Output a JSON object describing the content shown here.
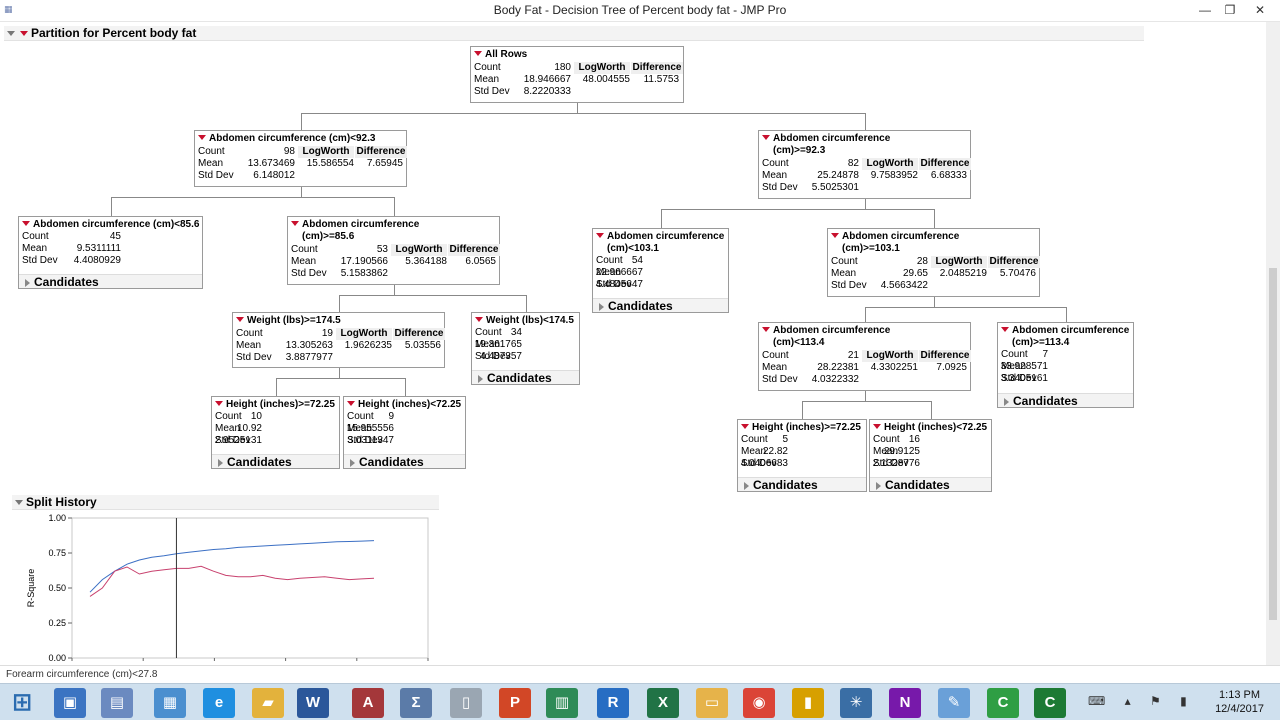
{
  "window": {
    "title": "Body Fat - Decision Tree of Percent body fat - JMP Pro",
    "minimize": "—",
    "maximize": "❐",
    "close": "✕"
  },
  "partition": {
    "header": "Partition for Percent body fat",
    "labels": {
      "count": "Count",
      "mean": "Mean",
      "std": "Std Dev",
      "logworth": "LogWorth",
      "difference": "Difference",
      "candidates": "Candidates"
    }
  },
  "nodes": [
    {
      "id": "root",
      "title": "All Rows",
      "title2": "",
      "count": "180",
      "mean": "18.946667",
      "std": "8.2220333",
      "logworth": "48.004555",
      "difference": "11.5753",
      "candidates": false
    },
    {
      "id": "n1",
      "title": "Abdomen circumference (cm)<92.3",
      "title2": "",
      "count": "98",
      "mean": "13.673469",
      "std": "6.148012",
      "logworth": "15.586554",
      "difference": "7.65945",
      "candidates": false
    },
    {
      "id": "n2",
      "title": "Abdomen circumference",
      "title2": "(cm)>=92.3",
      "count": "82",
      "mean": "25.24878",
      "std": "5.5025301",
      "logworth": "9.7583952",
      "difference": "6.68333",
      "candidates": false
    },
    {
      "id": "n3",
      "title": "Abdomen circumference (cm)<85.6",
      "title2": "",
      "count": "45",
      "mean": "9.5311111",
      "std": "4.4080929",
      "logworth": "",
      "difference": "",
      "candidates": true
    },
    {
      "id": "n4",
      "title": "Abdomen circumference",
      "title2": "(cm)>=85.6",
      "count": "53",
      "mean": "17.190566",
      "std": "5.1583862",
      "logworth": "5.364188",
      "difference": "6.0565",
      "candidates": false
    },
    {
      "id": "n5",
      "title": "Abdomen circumference",
      "title2": "(cm)<103.1",
      "count": "54",
      "mean": "22.966667",
      "std": "4.4845647",
      "logworth": "",
      "difference": "",
      "candidates": true
    },
    {
      "id": "n6",
      "title": "Abdomen circumference",
      "title2": "(cm)>=103.1",
      "count": "28",
      "mean": "29.65",
      "std": "4.5663422",
      "logworth": "2.0485219",
      "difference": "5.70476",
      "candidates": false
    },
    {
      "id": "n7",
      "title": "Weight (lbs)>=174.5",
      "title2": "",
      "count": "19",
      "mean": "13.305263",
      "std": "3.8877977",
      "logworth": "1.9626235",
      "difference": "5.03556",
      "candidates": false
    },
    {
      "id": "n8",
      "title": "Weight (lbs)<174.5",
      "title2": "",
      "count": "34",
      "mean": "19.361765",
      "std": "4.487357",
      "logworth": "",
      "difference": "",
      "candidates": true
    },
    {
      "id": "n9",
      "title": "Abdomen circumference",
      "title2": "(cm)<113.4",
      "count": "21",
      "mean": "28.22381",
      "std": "4.0322332",
      "logworth": "4.3302251",
      "difference": "7.0925",
      "candidates": false
    },
    {
      "id": "n10",
      "title": "Abdomen circumference",
      "title2": "(cm)>=113.4",
      "count": "7",
      "mean": "33.928571",
      "std": "3.3405161",
      "logworth": "",
      "difference": "",
      "candidates": true
    },
    {
      "id": "n11",
      "title": "Height (inches)>=72.25",
      "title2": "",
      "count": "10",
      "mean": "10.92",
      "std": "2.9525131",
      "logworth": "",
      "difference": "",
      "candidates": true
    },
    {
      "id": "n12",
      "title": "Height (inches)<72.25",
      "title2": "",
      "count": "9",
      "mean": "15.955556",
      "std": "3.0311347",
      "logworth": "",
      "difference": "",
      "candidates": true
    },
    {
      "id": "n13",
      "title": "Height (inches)>=72.25",
      "title2": "",
      "count": "5",
      "mean": "22.82",
      "std": "4.0406683",
      "logworth": "",
      "difference": "",
      "candidates": true
    },
    {
      "id": "n14",
      "title": "Height (inches)<72.25",
      "title2": "",
      "count": "16",
      "mean": "29.9125",
      "std": "2.1328776",
      "logworth": "",
      "difference": "",
      "candidates": true
    }
  ],
  "split_history": {
    "header": "Split History",
    "ylabel": "R-Square"
  },
  "chart_data": {
    "type": "line",
    "title": "",
    "xlabel": "",
    "ylabel": "R-Square",
    "ylim": [
      0,
      1
    ],
    "yticks": [
      "0.00",
      "0.25",
      "0.50",
      "0.75",
      "1.00"
    ],
    "x": [
      1,
      2,
      3,
      4,
      5,
      6,
      7,
      8,
      9,
      10,
      11,
      12,
      13,
      14,
      15,
      16,
      17,
      18,
      19,
      20,
      21,
      22,
      23,
      24
    ],
    "series": [
      {
        "color": "#3b6fc4",
        "values": [
          0.47,
          0.56,
          0.62,
          0.67,
          0.7,
          0.72,
          0.73,
          0.745,
          0.755,
          0.765,
          0.775,
          0.78,
          0.79,
          0.795,
          0.8,
          0.805,
          0.81,
          0.815,
          0.82,
          0.825,
          0.83,
          0.832,
          0.835,
          0.838
        ]
      },
      {
        "color": "#c8416e",
        "values": [
          0.44,
          0.5,
          0.62,
          0.65,
          0.6,
          0.62,
          0.63,
          0.64,
          0.64,
          0.655,
          0.62,
          0.59,
          0.58,
          0.58,
          0.59,
          0.57,
          0.56,
          0.57,
          0.575,
          0.58,
          0.57,
          0.56,
          0.565,
          0.57
        ]
      }
    ],
    "marker_x": 8
  },
  "status": {
    "text": "Forearm circumference (cm)<27.8"
  },
  "taskbar": {
    "icons": [
      {
        "name": "start-icon",
        "glyph": "⊞",
        "color": "#2b6cb0"
      },
      {
        "name": "computer-icon",
        "glyph": "▣",
        "color": "#3b74c2"
      },
      {
        "name": "file-explorer-icon",
        "glyph": "▤",
        "color": "#6b8ac0"
      },
      {
        "name": "calculator-icon",
        "glyph": "▦",
        "color": "#4b8fcf"
      },
      {
        "name": "internet-explorer-icon",
        "glyph": "e",
        "color": "#1f8fe0"
      },
      {
        "name": "folder-icon",
        "glyph": "▰",
        "color": "#e3b23c"
      },
      {
        "name": "word-icon",
        "glyph": "W",
        "color": "#2b579a"
      },
      {
        "name": "access-icon",
        "glyph": "A",
        "color": "#a4373a"
      },
      {
        "name": "sigma-icon",
        "glyph": "Σ",
        "color": "#5b7ba8"
      },
      {
        "name": "blank-document-icon",
        "glyph": "▯",
        "color": "#9aa6b2"
      },
      {
        "name": "powerpoint-icon",
        "glyph": "P",
        "color": "#d24726"
      },
      {
        "name": "project-icon",
        "glyph": "▥",
        "color": "#2e8b57"
      },
      {
        "name": "r-icon",
        "glyph": "R",
        "color": "#276dc3"
      },
      {
        "name": "excel-icon",
        "glyph": "X",
        "color": "#217346"
      },
      {
        "name": "explorer-folder-icon",
        "glyph": "▭",
        "color": "#e6b34a"
      },
      {
        "name": "chrome-icon",
        "glyph": "◉",
        "color": "#db4437"
      },
      {
        "name": "chart-app-icon",
        "glyph": "▮",
        "color": "#d7a000"
      },
      {
        "name": "network-app-icon",
        "glyph": "✳",
        "color": "#3a6ea5"
      },
      {
        "name": "onenote-icon",
        "glyph": "N",
        "color": "#7719aa"
      },
      {
        "name": "paint-icon",
        "glyph": "✎",
        "color": "#6aa0d8"
      },
      {
        "name": "camtasia-icon",
        "glyph": "C",
        "color": "#2f9e44"
      },
      {
        "name": "camtasia-recorder-icon",
        "glyph": "C",
        "color": "#1d7a34"
      }
    ],
    "time": "1:13 PM",
    "date": "12/4/2017"
  }
}
